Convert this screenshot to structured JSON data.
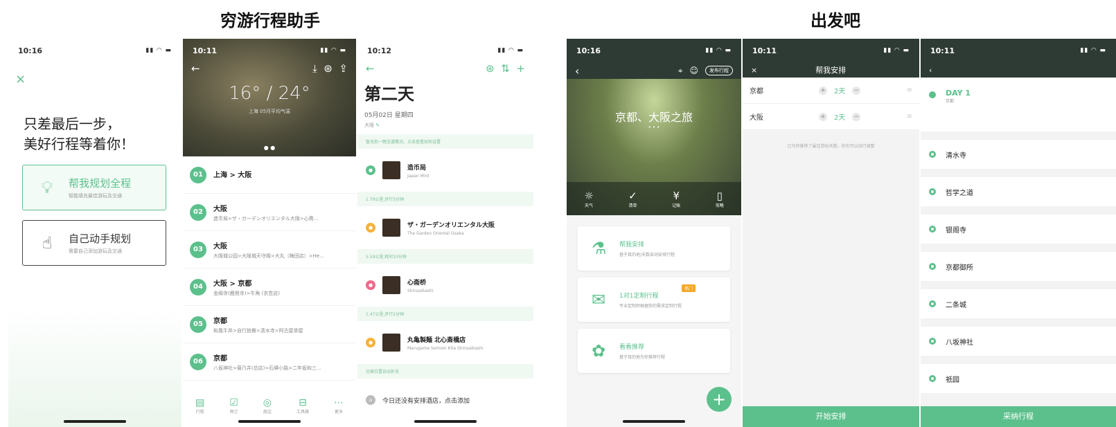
{
  "titles": {
    "left": "穷游行程助手",
    "right": "出发吧"
  },
  "p1": {
    "time": "10:16",
    "close": "×",
    "headline": "只差最后一步，\n美好行程等着你！",
    "card1": {
      "title": "帮我规划全程",
      "sub": "智能填充最佳游玩及交通"
    },
    "card2": {
      "title": "自己动手规划",
      "sub": "需要自己添加游玩及交通"
    }
  },
  "p2": {
    "time": "10:11",
    "temp": "16° / 24°",
    "temp_sub": "上海 05月平均气温",
    "days": [
      {
        "n": "01",
        "title": "上海 > 大阪",
        "sub": ""
      },
      {
        "n": "02",
        "title": "大阪",
        "sub": "造币局>ザ・ガーデンオリエンタル大阪>心斋..."
      },
      {
        "n": "03",
        "title": "大阪",
        "sub": "大阪城公园>大阪城天守阁>大丸（梅田店）>He..."
      },
      {
        "n": "04",
        "title": "大阪 > 京都",
        "sub": "金阁寺(鹿苑寺)>牛角 (衣笠店)"
      },
      {
        "n": "05",
        "title": "京都",
        "sub": "和風牛丼>自行就餐>清水寺>阿古屋茶屋"
      },
      {
        "n": "06",
        "title": "京都",
        "sub": "八坂神社>菊乃井(总店)>石塀小路>二年坂和三..."
      }
    ],
    "tabs": [
      {
        "icon": "▤",
        "label": "行程"
      },
      {
        "icon": "☑",
        "label": "预订"
      },
      {
        "icon": "◎",
        "label": "周边"
      },
      {
        "icon": "⊟",
        "label": "工具箱"
      },
      {
        "icon": "⋯",
        "label": "更多"
      }
    ]
  },
  "p3": {
    "time": "10:12",
    "title": "第二天",
    "date": "05月02日 星期四",
    "city": "大阪",
    "hint1": "暂无前一晚交通情况，点击查看如何设置",
    "pois": [
      {
        "name": "造币局",
        "en": "Japan Mint",
        "color": "#5cc08c"
      },
      {
        "name": "ザ・ガーデンオリエンタル大阪",
        "en": "The Garden Oriental Osaka",
        "color": "#f5b23b"
      },
      {
        "name": "心斋桥",
        "en": "Shinsaibashi",
        "color": "#ef6b8a"
      },
      {
        "name": "丸亀製麺 北心斎橋店",
        "en": "Marugame Seimen Kita Shinsaibashi",
        "color": "#f5b23b"
      }
    ],
    "transits": [
      "1.79公里,步行3分钟",
      "5.59公里,耗时10分钟",
      "1.47公里,步行2分钟"
    ],
    "hint2": "住宿位置自动补充",
    "hotel": "今日还没有安排酒店，点击添加"
  },
  "p4": {
    "time": "10:16",
    "publish": "发布行程",
    "trip": "京都、大阪之旅",
    "tools": [
      {
        "icon": "☼",
        "label": "天气"
      },
      {
        "icon": "✓",
        "label": "清单"
      },
      {
        "icon": "¥",
        "label": "记账"
      },
      {
        "icon": "▯",
        "label": "攻略"
      }
    ],
    "options": [
      {
        "icon": "⚗",
        "title": "帮我安排",
        "sub": "基于目的地/天数自动安排行程",
        "tag": ""
      },
      {
        "icon": "✉",
        "title": "1对1定制行程",
        "sub": "专业定制师根据你的需求定制行程",
        "tag": "热门"
      },
      {
        "icon": "✿",
        "title": "看看推荐",
        "sub": "基于目的地为你推荐行程",
        "tag": ""
      }
    ]
  },
  "p5": {
    "time": "10:11",
    "title": "帮我安排",
    "cities": [
      {
        "name": "京都",
        "days": "2天"
      },
      {
        "name": "大阪",
        "days": "2天"
      }
    ],
    "note": "已为你推荐了最佳游玩天数，你也可以自行调整",
    "button": "开始安排"
  },
  "p6": {
    "time": "10:11",
    "day": "DAY 1",
    "day_city": "京都",
    "spots": [
      "清水寺",
      "哲学之道",
      "银阁寺",
      "京都御所",
      "二条城",
      "八坂神社",
      "祇园"
    ],
    "button": "采纳行程"
  }
}
